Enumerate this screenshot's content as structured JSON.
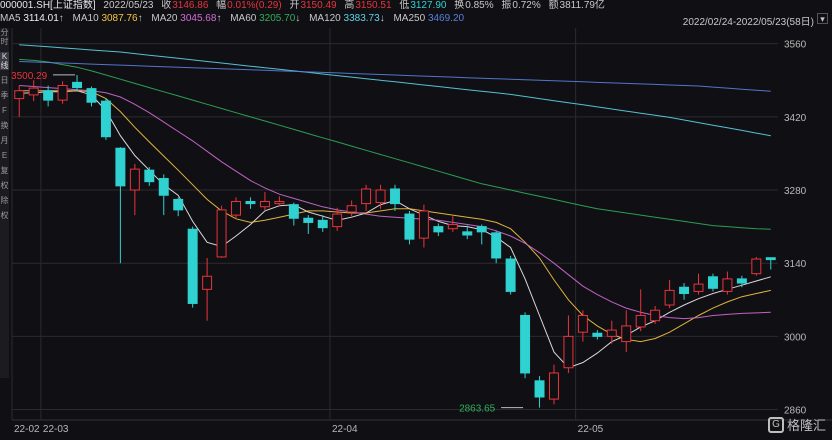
{
  "header": {
    "code": "000001.SH[上证指数]",
    "date": "2022/05/23",
    "close_label": "收",
    "close": "3146.86",
    "change_label": "幅",
    "change": "0.01%(0.29)",
    "open_label": "开",
    "open": "3150.49",
    "high_label": "高",
    "high": "3150.51",
    "low_label": "低",
    "low": "3127.90",
    "turnover_label": "换",
    "turnover": "0.85%",
    "amplitude_label": "振",
    "amplitude": "0.72%",
    "amount_label": "额",
    "amount": "3811.79亿"
  },
  "ma_bar": {
    "items": [
      {
        "label": "MA5",
        "value": "3114.01",
        "color": "#f0f0f0"
      },
      {
        "label": "MA10",
        "value": "3087.76",
        "color": "#f5c542"
      },
      {
        "label": "MA20",
        "value": "3045.68",
        "color": "#d36cd8"
      },
      {
        "label": "MA60",
        "value": "3205.70",
        "color": "#2fae5a"
      },
      {
        "label": "MA120",
        "value": "3383.73",
        "color": "#5fd3e6"
      },
      {
        "label": "MA250",
        "value": "3469.20",
        "color": "#5b7fe0"
      }
    ],
    "range": "2022/02/24-2022/05/23(58日)",
    "range_icon": "chevron-down-icon"
  },
  "side_tabs": [
    "分时",
    "K线",
    "日",
    "季",
    "F",
    "换",
    "月",
    "E",
    "复",
    "权",
    "除",
    "权"
  ],
  "watermark": {
    "text": "格隆汇",
    "icon": "G"
  },
  "colors": {
    "up": "#e8343b",
    "down": "#2fd1d1",
    "grid": "#2a2a30",
    "bg": "#101014"
  },
  "chart_data": {
    "type": "candlestick",
    "ylim": [
      2840,
      3590
    ],
    "yticks": [
      3560,
      3420,
      3280,
      3140,
      3000,
      2860
    ],
    "xticks": [
      {
        "label": "22-02",
        "index": 0
      },
      {
        "label": "22-03",
        "index": 2
      },
      {
        "label": "22-04",
        "index": 22
      },
      {
        "label": "22-05",
        "index": 39
      }
    ],
    "annotations": [
      {
        "text": "3500.29",
        "index": 4,
        "value": 3500.29,
        "side": "left",
        "color": "#e8343b"
      },
      {
        "text": "2863.65",
        "index": 35,
        "value": 2863.65,
        "side": "left",
        "color": "#2fae5a"
      }
    ],
    "candles": [
      {
        "o": 3455,
        "c": 3470,
        "h": 3480,
        "l": 3420
      },
      {
        "o": 3462,
        "c": 3475,
        "h": 3490,
        "l": 3450
      },
      {
        "o": 3470,
        "c": 3452,
        "h": 3480,
        "l": 3440
      },
      {
        "o": 3452,
        "c": 3480,
        "h": 3488,
        "l": 3445
      },
      {
        "o": 3486,
        "c": 3476,
        "h": 3500,
        "l": 3468
      },
      {
        "o": 3474,
        "c": 3448,
        "h": 3478,
        "l": 3440
      },
      {
        "o": 3450,
        "c": 3382,
        "h": 3456,
        "l": 3376
      },
      {
        "o": 3360,
        "c": 3288,
        "h": 3362,
        "l": 3140
      },
      {
        "o": 3280,
        "c": 3320,
        "h": 3330,
        "l": 3232
      },
      {
        "o": 3318,
        "c": 3296,
        "h": 3324,
        "l": 3288
      },
      {
        "o": 3302,
        "c": 3270,
        "h": 3310,
        "l": 3232
      },
      {
        "o": 3262,
        "c": 3242,
        "h": 3266,
        "l": 3230
      },
      {
        "o": 3205,
        "c": 3063,
        "h": 3210,
        "l": 3055
      },
      {
        "o": 3090,
        "c": 3115,
        "h": 3150,
        "l": 3030
      },
      {
        "o": 3152,
        "c": 3242,
        "h": 3250,
        "l": 3150
      },
      {
        "o": 3232,
        "c": 3258,
        "h": 3266,
        "l": 3224
      },
      {
        "o": 3258,
        "c": 3254,
        "h": 3266,
        "l": 3244
      },
      {
        "o": 3248,
        "c": 3258,
        "h": 3276,
        "l": 3240
      },
      {
        "o": 3254,
        "c": 3258,
        "h": 3268,
        "l": 3248
      },
      {
        "o": 3252,
        "c": 3226,
        "h": 3256,
        "l": 3212
      },
      {
        "o": 3226,
        "c": 3218,
        "h": 3232,
        "l": 3196
      },
      {
        "o": 3222,
        "c": 3208,
        "h": 3232,
        "l": 3200
      },
      {
        "o": 3210,
        "c": 3234,
        "h": 3246,
        "l": 3202
      },
      {
        "o": 3238,
        "c": 3250,
        "h": 3260,
        "l": 3230
      },
      {
        "o": 3254,
        "c": 3282,
        "h": 3290,
        "l": 3240
      },
      {
        "o": 3256,
        "c": 3280,
        "h": 3290,
        "l": 3244
      },
      {
        "o": 3282,
        "c": 3254,
        "h": 3290,
        "l": 3240
      },
      {
        "o": 3234,
        "c": 3186,
        "h": 3240,
        "l": 3176
      },
      {
        "o": 3188,
        "c": 3240,
        "h": 3252,
        "l": 3170
      },
      {
        "o": 3210,
        "c": 3200,
        "h": 3216,
        "l": 3192
      },
      {
        "o": 3206,
        "c": 3214,
        "h": 3230,
        "l": 3200
      },
      {
        "o": 3200,
        "c": 3194,
        "h": 3212,
        "l": 3186
      },
      {
        "o": 3210,
        "c": 3200,
        "h": 3214,
        "l": 3176
      },
      {
        "o": 3198,
        "c": 3150,
        "h": 3202,
        "l": 3140
      },
      {
        "o": 3148,
        "c": 3086,
        "h": 3154,
        "l": 3080
      },
      {
        "o": 3040,
        "c": 2930,
        "h": 3046,
        "l": 2920
      },
      {
        "o": 2915,
        "c": 2884,
        "h": 2924,
        "l": 2863.65
      },
      {
        "o": 2880,
        "c": 2930,
        "h": 2946,
        "l": 2870
      },
      {
        "o": 2940,
        "c": 3000,
        "h": 3040,
        "l": 2930
      },
      {
        "o": 3008,
        "c": 3040,
        "h": 3050,
        "l": 2990
      },
      {
        "o": 3006,
        "c": 3000,
        "h": 3012,
        "l": 2994
      },
      {
        "o": 3000,
        "c": 3012,
        "h": 3030,
        "l": 2986
      },
      {
        "o": 2990,
        "c": 3020,
        "h": 3050,
        "l": 2970
      },
      {
        "o": 3018,
        "c": 3040,
        "h": 3090,
        "l": 3010
      },
      {
        "o": 3030,
        "c": 3050,
        "h": 3058,
        "l": 3024
      },
      {
        "o": 3060,
        "c": 3088,
        "h": 3108,
        "l": 3054
      },
      {
        "o": 3094,
        "c": 3082,
        "h": 3102,
        "l": 3070
      },
      {
        "o": 3086,
        "c": 3100,
        "h": 3120,
        "l": 3080
      },
      {
        "o": 3114,
        "c": 3092,
        "h": 3120,
        "l": 3086
      },
      {
        "o": 3086,
        "c": 3110,
        "h": 3124,
        "l": 3080
      },
      {
        "o": 3110,
        "c": 3102,
        "h": 3116,
        "l": 3094
      },
      {
        "o": 3120,
        "c": 3148,
        "h": 3152,
        "l": 3116
      },
      {
        "o": 3150.49,
        "c": 3146.86,
        "h": 3150.51,
        "l": 3127.9
      }
    ],
    "series": [
      {
        "name": "MA5",
        "color": "#f0f0f0",
        "values": [
          3465,
          3466,
          3468,
          3468,
          3470,
          3462,
          3432,
          3384,
          3346,
          3318,
          3290,
          3270,
          3220,
          3180,
          3172,
          3192,
          3214,
          3240,
          3250,
          3252,
          3238,
          3230,
          3222,
          3228,
          3236,
          3252,
          3260,
          3244,
          3232,
          3220,
          3212,
          3210,
          3204,
          3190,
          3170,
          3110,
          3040,
          2970,
          2940,
          2950,
          2968,
          2990,
          3002,
          3018,
          3030,
          3046,
          3060,
          3072,
          3082,
          3090,
          3098,
          3106,
          3114
        ]
      },
      {
        "name": "MA10",
        "color": "#f5c542",
        "values": [
          3470,
          3470,
          3470,
          3470,
          3470,
          3468,
          3455,
          3430,
          3400,
          3372,
          3345,
          3318,
          3290,
          3262,
          3240,
          3225,
          3218,
          3222,
          3228,
          3234,
          3240,
          3240,
          3238,
          3236,
          3236,
          3240,
          3244,
          3244,
          3240,
          3236,
          3232,
          3228,
          3224,
          3218,
          3206,
          3180,
          3150,
          3108,
          3070,
          3040,
          3020,
          3004,
          2994,
          2990,
          2996,
          3008,
          3024,
          3040,
          3054,
          3066,
          3076,
          3082,
          3088
        ]
      },
      {
        "name": "MA20",
        "color": "#d36cd8",
        "values": [
          3480,
          3478,
          3476,
          3474,
          3472,
          3470,
          3466,
          3458,
          3444,
          3428,
          3410,
          3392,
          3374,
          3354,
          3334,
          3316,
          3298,
          3284,
          3272,
          3264,
          3256,
          3248,
          3242,
          3238,
          3234,
          3230,
          3228,
          3226,
          3224,
          3222,
          3218,
          3214,
          3210,
          3202,
          3192,
          3178,
          3160,
          3140,
          3118,
          3096,
          3080,
          3066,
          3054,
          3046,
          3040,
          3036,
          3034,
          3036,
          3040,
          3042,
          3044,
          3045,
          3046
        ]
      },
      {
        "name": "MA60",
        "color": "#2fae5a",
        "values": [
          3530,
          3528,
          3525,
          3520,
          3515,
          3508,
          3500,
          3492,
          3484,
          3476,
          3468,
          3460,
          3452,
          3444,
          3436,
          3428,
          3420,
          3412,
          3404,
          3396,
          3388,
          3380,
          3372,
          3364,
          3356,
          3348,
          3340,
          3332,
          3324,
          3316,
          3308,
          3300,
          3292,
          3286,
          3280,
          3274,
          3268,
          3262,
          3256,
          3250,
          3244,
          3240,
          3236,
          3232,
          3228,
          3224,
          3220,
          3216,
          3212,
          3210,
          3208,
          3206,
          3205
        ]
      },
      {
        "name": "MA120",
        "color": "#5fd3e6",
        "values": [
          3558,
          3556,
          3554,
          3552,
          3550,
          3548,
          3546,
          3544,
          3541,
          3538,
          3535,
          3532,
          3529,
          3526,
          3523,
          3520,
          3517,
          3514,
          3511,
          3508,
          3505,
          3502,
          3499,
          3496,
          3493,
          3490,
          3487,
          3484,
          3481,
          3478,
          3475,
          3472,
          3469,
          3466,
          3463,
          3459,
          3455,
          3451,
          3447,
          3443,
          3439,
          3435,
          3431,
          3427,
          3423,
          3419,
          3414,
          3409,
          3404,
          3399,
          3394,
          3389,
          3384
        ]
      },
      {
        "name": "MA250",
        "color": "#5b7fe0",
        "values": [
          3526,
          3525,
          3524,
          3523,
          3522,
          3521,
          3520,
          3519,
          3518,
          3517,
          3516,
          3515,
          3514,
          3513,
          3512,
          3511,
          3510,
          3509,
          3508,
          3507,
          3506,
          3505,
          3504,
          3503,
          3502,
          3501,
          3500,
          3499,
          3498,
          3497,
          3496,
          3495,
          3494,
          3493,
          3492,
          3491,
          3490,
          3489,
          3488,
          3487,
          3486,
          3485,
          3484,
          3483,
          3482,
          3481,
          3480,
          3479,
          3477,
          3475,
          3473,
          3471,
          3469
        ]
      }
    ]
  }
}
